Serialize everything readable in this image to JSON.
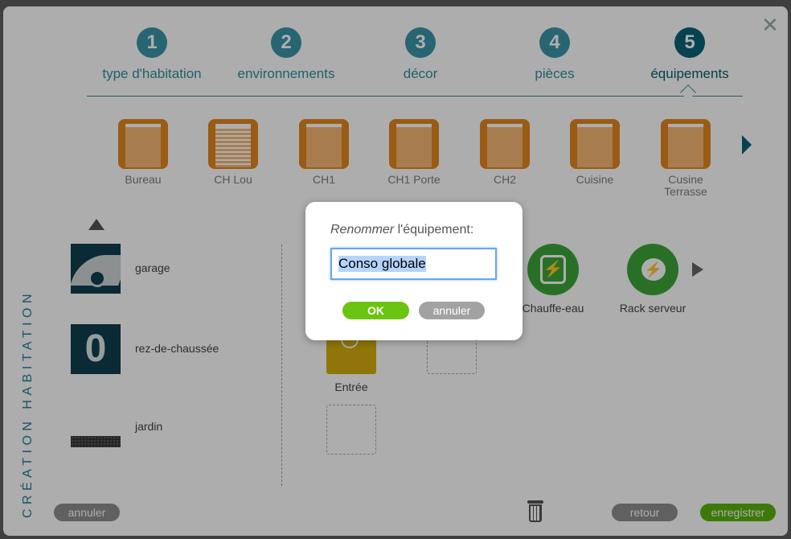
{
  "window": {
    "close_glyph": "✕"
  },
  "steps": [
    {
      "num": "1",
      "label": "type d'habitation"
    },
    {
      "num": "2",
      "label": "environnements"
    },
    {
      "num": "3",
      "label": "décor"
    },
    {
      "num": "4",
      "label": "pièces"
    },
    {
      "num": "5",
      "label": "équipements",
      "active": true
    }
  ],
  "rooms": [
    {
      "label": "Bureau"
    },
    {
      "label": "CH Lou"
    },
    {
      "label": "CH1"
    },
    {
      "label": "CH1 Porte"
    },
    {
      "label": "CH2"
    },
    {
      "label": "Cuisine"
    },
    {
      "label": "Cusine Terrasse"
    }
  ],
  "sidebar": {
    "title": "CRÉATION HABITATION"
  },
  "levels": [
    {
      "name": "garage",
      "icon": "garage-car-icon"
    },
    {
      "name": "rez-de-chaussée",
      "icon": "floor-zero-icon"
    },
    {
      "name": "jardin",
      "icon": "garden-icon"
    }
  ],
  "equipment": [
    {
      "label": "Chauffe-eau",
      "icon": "power-outlet-icon"
    },
    {
      "label": "Rack serveur",
      "icon": "plug-icon"
    },
    {
      "label": "Entrée",
      "icon": "light-bulb-icon"
    }
  ],
  "footer": {
    "cancel_label": "annuler",
    "back_label": "retour",
    "save_label": "enregistrer"
  },
  "dialog": {
    "title_italic": "Renommer",
    "title_rest": " l'équipement:",
    "input_value": "Conso globale",
    "ok_label": "OK",
    "cancel_label": "annuler"
  },
  "colors": {
    "accent": "#2f8ea1",
    "accent_dark": "#0b6277",
    "room_orange": "#e4861f",
    "equip_green": "#3da53a",
    "ok_green": "#6bc410",
    "save_green": "#5bb30d"
  }
}
